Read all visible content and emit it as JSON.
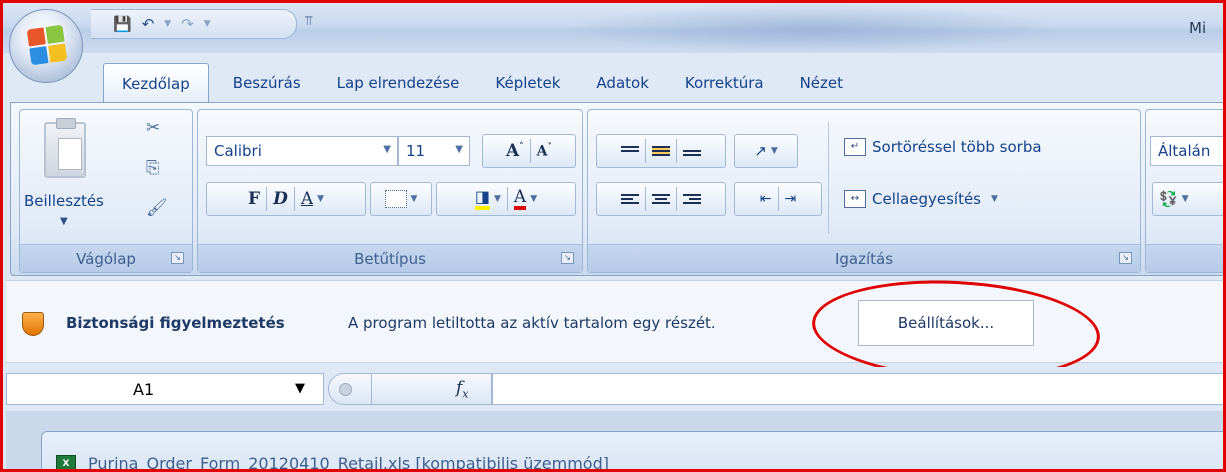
{
  "window": {
    "title_partial": "Mi"
  },
  "quick_access": {
    "icons": [
      "save-icon",
      "undo-icon",
      "redo-icon",
      "customize-icon"
    ]
  },
  "tabs": [
    {
      "label": "Kezdőlap",
      "active": true
    },
    {
      "label": "Beszúrás"
    },
    {
      "label": "Lap elrendezése"
    },
    {
      "label": "Képletek"
    },
    {
      "label": "Adatok"
    },
    {
      "label": "Korrektúra"
    },
    {
      "label": "Nézet"
    }
  ],
  "ribbon": {
    "clipboard": {
      "paste_label": "Beillesztés",
      "group_label": "Vágólap"
    },
    "font": {
      "font_name": "Calibri",
      "font_size": "11",
      "bold": "F",
      "italic": "D",
      "underline": "A",
      "font_color": "A",
      "group_label": "Betűtípus"
    },
    "alignment": {
      "wrap_text": "Sortöréssel több sorba",
      "merge": "Cellaegyesítés",
      "group_label": "Igazítás"
    },
    "number": {
      "format_partial": "Általán"
    }
  },
  "security_bar": {
    "title": "Biztonsági figyelmeztetés",
    "message": "A program letiltotta az aktív tartalom egy részét.",
    "options_button": "Beállítások..."
  },
  "formula_bar": {
    "name_box": "A1",
    "fx": "fx",
    "formula": ""
  },
  "workbook": {
    "title": "Purina_Order_Form_20120410_Retail.xls  [kompatibilis üzemmód]"
  },
  "colors": {
    "highlight": "#e00000",
    "ribbon_text": "#15428b",
    "accent_active": "#ffc95c"
  }
}
